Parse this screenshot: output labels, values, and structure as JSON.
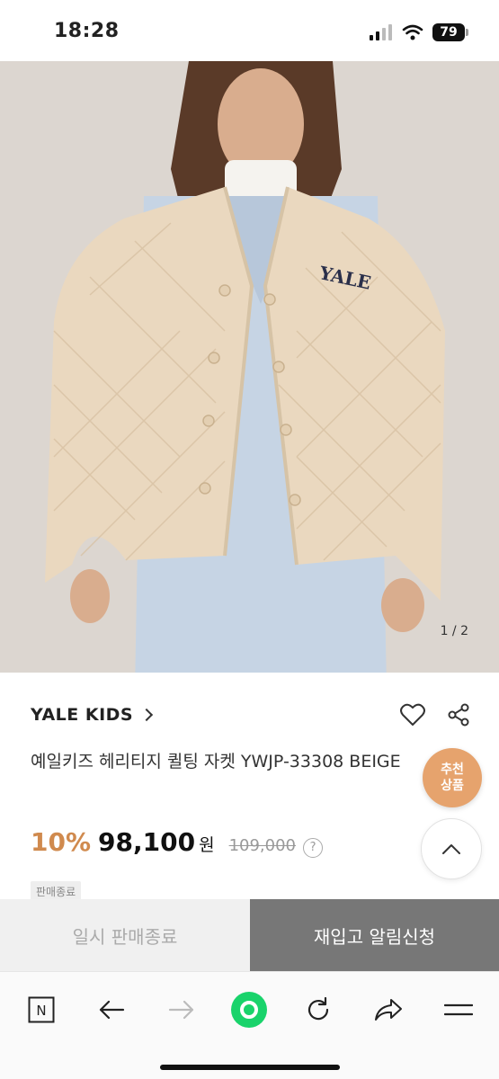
{
  "status_bar": {
    "time": "18:28",
    "battery": "79"
  },
  "image": {
    "counter": "1 / 2"
  },
  "product": {
    "brand": "YALE KIDS",
    "title": "예일키즈 헤리티지 퀼팅 자켓 YWJP-33308 BEIGE",
    "discount": "10%",
    "price": "98,100",
    "currency": "원",
    "original_price": "109,000",
    "help": "?",
    "sale_tag": "판매종료"
  },
  "badge": {
    "line1": "추천",
    "line2": "상품"
  },
  "actions": {
    "paused_label": "일시 판매종료",
    "restock_label": "재입고 알림신청"
  },
  "colors": {
    "accent": "#d08a4e",
    "badge": "#e6a36d",
    "toolbar_green": "#19d36b"
  },
  "toolbar": {
    "n_label": "N"
  }
}
